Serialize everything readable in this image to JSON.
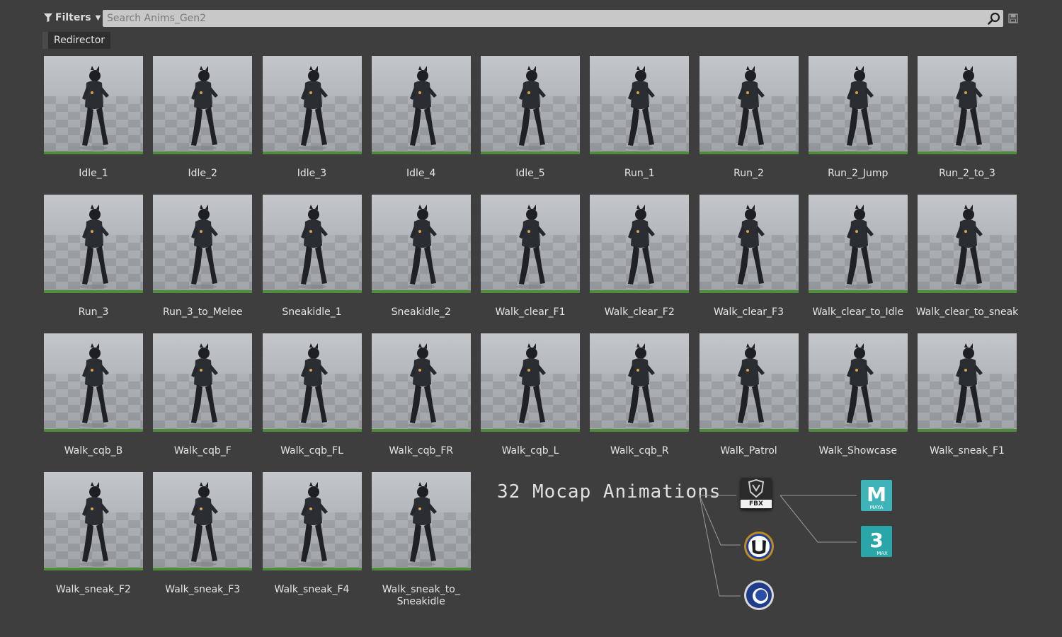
{
  "toolbar": {
    "filters_label": "Filters",
    "search_placeholder": "Search Anims_Gen2"
  },
  "chips": {
    "redirector_label": "Redirector"
  },
  "assets": [
    "Idle_1",
    "Idle_2",
    "Idle_3",
    "Idle_4",
    "Idle_5",
    "Run_1",
    "Run_2",
    "Run_2_Jump",
    "Run_2_to_3",
    "Run_3",
    "Run_3_to_Melee",
    "Sneakidle_1",
    "Sneakidle_2",
    "Walk_clear_F1",
    "Walk_clear_F2",
    "Walk_clear_F3",
    "Walk_clear_to_Idle",
    "Walk_clear_to_sneak",
    "Walk_cqb_B",
    "Walk_cqb_F",
    "Walk_cqb_FL",
    "Walk_cqb_FR",
    "Walk_cqb_L",
    "Walk_cqb_R",
    "Walk_Patrol",
    "Walk_Showcase",
    "Walk_sneak_F1",
    "Walk_sneak_F2",
    "Walk_sneak_F3",
    "Walk_sneak_F4",
    "Walk_sneak_to_\nSneakidle"
  ],
  "promo": {
    "headline": "32 Mocap Animations",
    "fbx_badge_text": "FBX",
    "maya_badge_text": "MAYA",
    "max_badge_text": "MAX",
    "icons": [
      "fbx-icon",
      "unreal-engine-icon",
      "cinema4d-icon",
      "maya-icon",
      "3dsmax-icon"
    ]
  },
  "colors": {
    "background": "#3e3e3e",
    "thumbnail_bar": "#4f8d3c",
    "search_field": "#c8c8c8"
  }
}
